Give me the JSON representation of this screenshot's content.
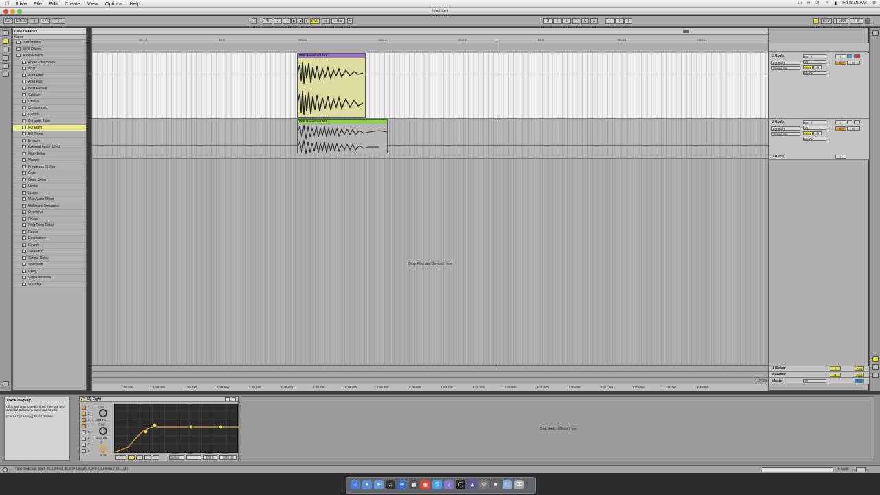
{
  "menubar": {
    "apple": "",
    "items": [
      "Live",
      "File",
      "Edit",
      "Create",
      "View",
      "Options",
      "Help"
    ],
    "clock": "Fri 5:15 AM"
  },
  "window": {
    "title": "Untitled"
  },
  "transport": {
    "tap": "TAP",
    "tempo": "120.00",
    "meter": "4 / 4",
    "position": [
      "45",
      "2",
      "4"
    ],
    "ovr": "OVR",
    "quantize": "1 Bar",
    "loop_start": [
      "3",
      "1",
      "1"
    ],
    "loop_length": [
      "4",
      "0",
      "0"
    ],
    "key": "KEY",
    "midi": "MIDI",
    "cpu": "4 %"
  },
  "browser": {
    "title": "Live Devices",
    "column": "Name",
    "folders": [
      "Instruments",
      "MIDI Effects",
      "Audio Effects"
    ],
    "items": [
      "Audio Effect Rack",
      "Amp",
      "Auto Filter",
      "Auto Pan",
      "Beat Repeat",
      "Cabinet",
      "Chorus",
      "Compressor",
      "Corpus",
      "Dynamic Tube",
      "EQ Eight",
      "EQ Three",
      "Erosion",
      "External Audio Effect",
      "Filter Delay",
      "Flanger",
      "Frequency Shifter",
      "Gate",
      "Grain Delay",
      "Limiter",
      "Looper",
      "Max Audio Effect",
      "Multiband Dynamics",
      "Overdrive",
      "Phaser",
      "Ping Pong Delay",
      "Redux",
      "Resonators",
      "Reverb",
      "Saturator",
      "Simple Delay",
      "Spectrum",
      "Utility",
      "Vinyl Distortion",
      "Vocoder"
    ],
    "selected_index": 10
  },
  "ruler": {
    "bars": [
      "45.1.4",
      "45.2",
      "45.2.2",
      "45.2.3",
      "45.2.4",
      "45.3",
      "45.3.2",
      "45.3.3"
    ],
    "bottom": [
      "1:29.300",
      "1:29.400",
      "1:29.450",
      "1:29.500",
      "1:29.550",
      "1:29.600",
      "1:29.650",
      "1:29.700",
      "1:29.750",
      "1:29.800",
      "1:29.850",
      "1:29.900",
      "1:29.950",
      "1:30.000",
      "1:30.050",
      "1:30.100",
      "1:30.150",
      "1:30.200",
      "1:30.250"
    ]
  },
  "clips": [
    {
      "name": "VEE Bassdrum 117",
      "color": "#9b74cc",
      "body": "#dcdca0"
    },
    {
      "name": "VEE Bassdrum 001",
      "color": "#8fd14f",
      "body": "#b6b6b6"
    }
  ],
  "arrangement": {
    "drop_text": "Drop Files and Devices Here",
    "zoom": "1/256"
  },
  "mixer": {
    "tracks": [
      {
        "name": "1 Audio",
        "input": "Ext. In",
        "device": "EQ Eight",
        "chan": "1/2",
        "state": "Device On",
        "auto": "Auto",
        "off": "Off",
        "out": "Master",
        "num": "1",
        "vol": "-8.0",
        "pan": "C"
      },
      {
        "name": "2 Audio",
        "input": "Ext. In",
        "device": "EQ Eight",
        "chan": "1/2",
        "state": "Device On",
        "auto": "Auto",
        "off": "Off",
        "out": "Master",
        "num": "2",
        "vol": "-8.0",
        "pan": "C"
      },
      {
        "name": "3 Audio",
        "num": "3"
      }
    ],
    "returns": [
      {
        "name": "A Return",
        "letter": "A",
        "label": "Post"
      },
      {
        "name": "B Return",
        "letter": "B",
        "label": "Post"
      }
    ],
    "master": {
      "name": "Master",
      "chan": "1/2",
      "label": "Post"
    }
  },
  "info_view": {
    "title": "Track Display",
    "text1": "Click and drag to select time, then use any available Edit menu command to edit.",
    "text2": "[Cmd + Opt + Drag] Scroll Display"
  },
  "eq_device": {
    "title": "EQ Eight",
    "freq_label": "Freq",
    "freq_value": "264 Hz",
    "gain_label": "Gain",
    "gain_value": "1.46 dB",
    "q_label": "Q",
    "q_value": "2.26",
    "bands": [
      "1",
      "2",
      "3",
      "4",
      "5",
      "6",
      "7",
      "8"
    ],
    "mode_label": "Mode",
    "mode_value": "Stereo",
    "edit_label": "Edit",
    "scale_label": "Scale",
    "scale_value": "100 %",
    "gain_out_label": "Gain",
    "gain_out_value": "0.00 dB"
  },
  "detail": {
    "drop_text": "Drop Audio Effects Here"
  },
  "status": {
    "left": "Time Selection   Start: 45.2.3   End: 45.2.3+   Length: 0.0.0+  (Duration: 0:00.136)",
    "right": "1-Audio"
  }
}
